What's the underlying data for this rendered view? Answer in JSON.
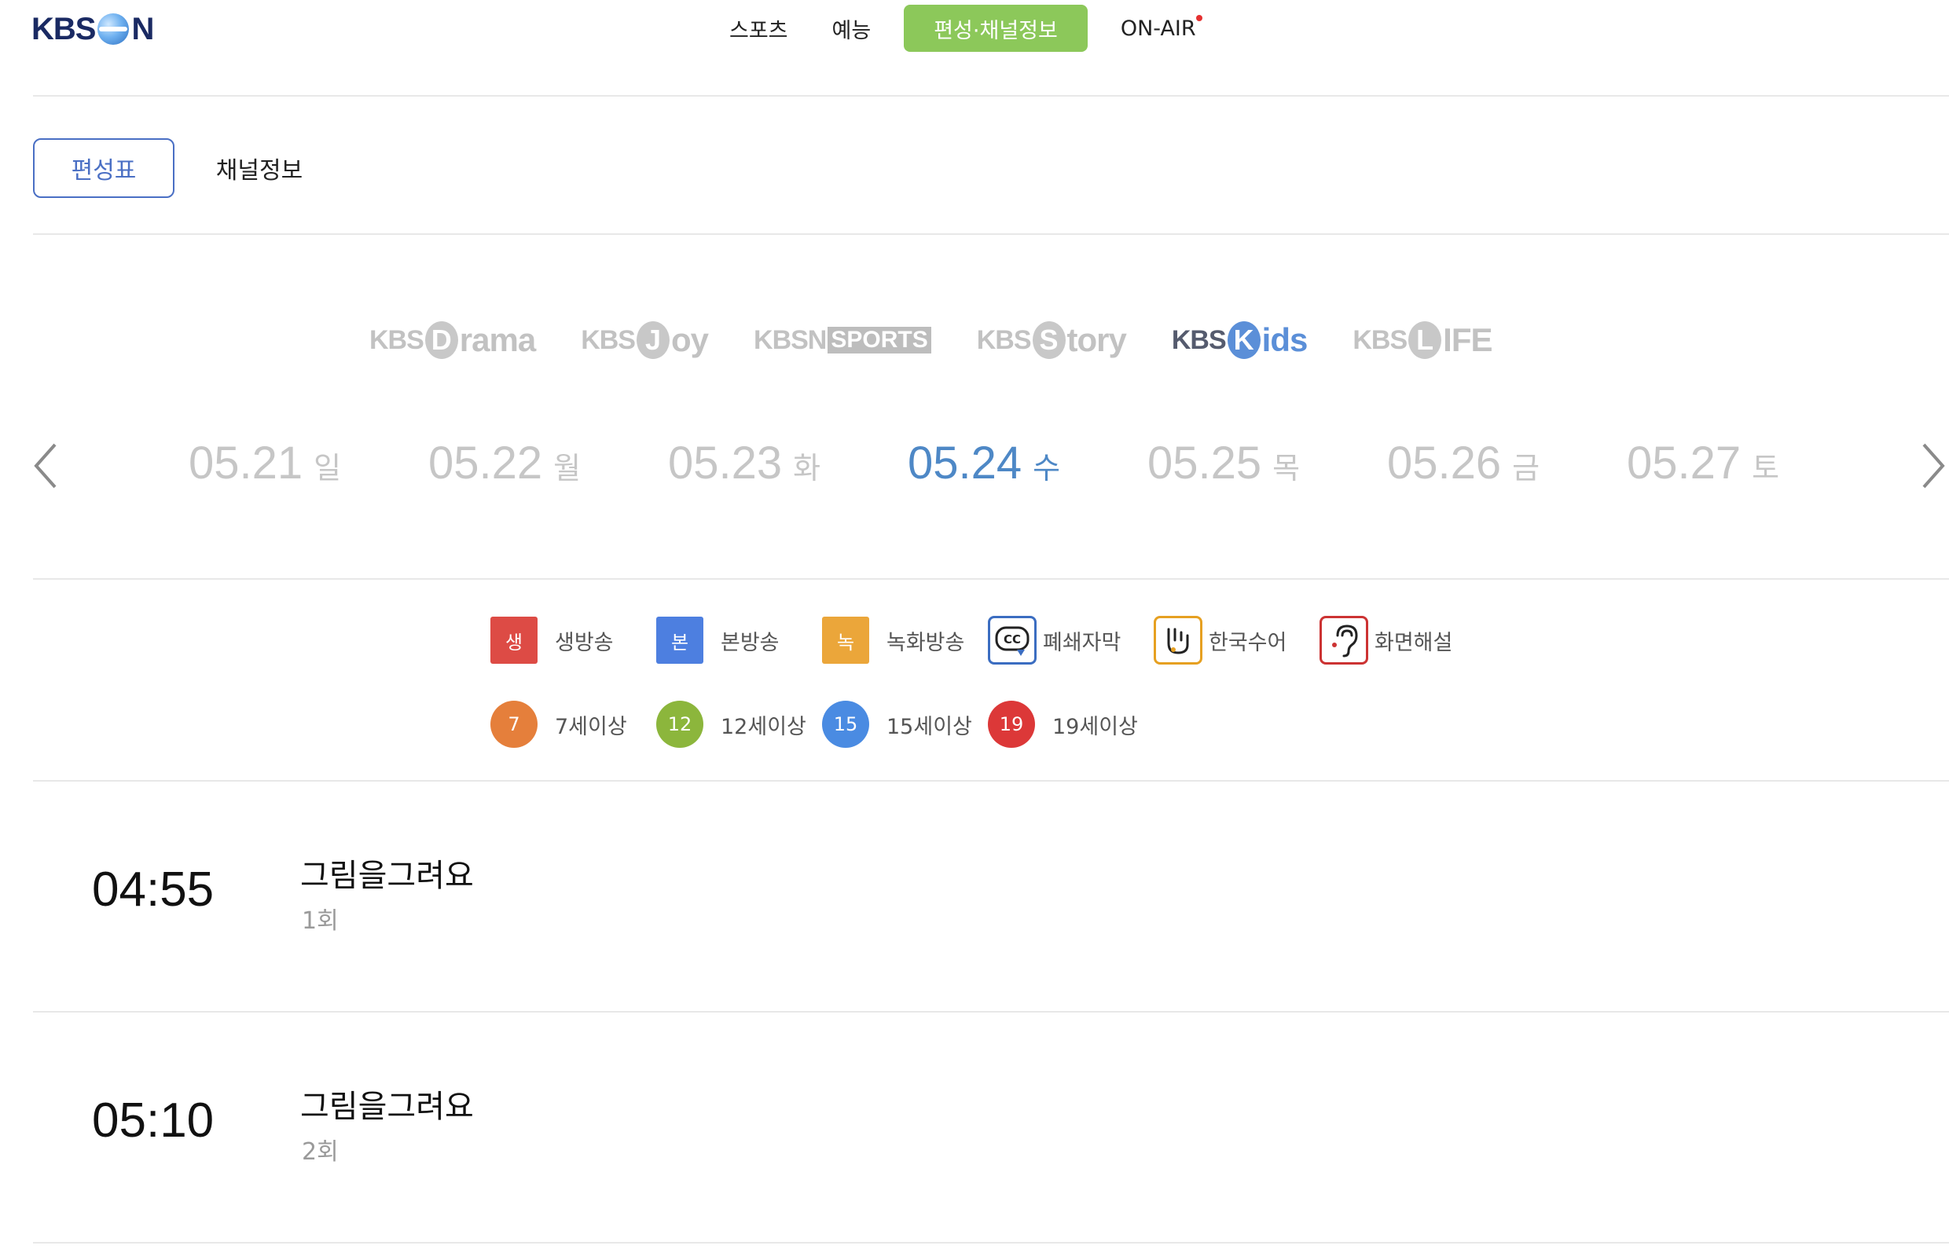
{
  "brand": {
    "logo_left": "KBS",
    "logo_right": "N"
  },
  "topnav": {
    "items": [
      {
        "label": "스포츠"
      },
      {
        "label": "예능"
      },
      {
        "label": "편성·채널정보"
      },
      {
        "label": "ON-AIR"
      }
    ],
    "active_index": 2,
    "active_color": "#8cc85a"
  },
  "subtabs": [
    {
      "label": "편성표",
      "active": true
    },
    {
      "label": "채널정보",
      "active": false
    }
  ],
  "channels": [
    {
      "prefix": "KBS",
      "badge": "D",
      "suffix": "rama"
    },
    {
      "prefix": "KBS",
      "badge": "J",
      "suffix": "oy"
    },
    {
      "prefix": "KBSN",
      "badge": "",
      "suffix": "SPORTS"
    },
    {
      "prefix": "KBS",
      "badge": "S",
      "suffix": "tory"
    },
    {
      "prefix": "KBS",
      "badge": "K",
      "suffix": "ids",
      "selected": true
    },
    {
      "prefix": "KBS",
      "badge": "L",
      "suffix": "IFE"
    }
  ],
  "dates": [
    {
      "date": "05.21",
      "weekday": "일"
    },
    {
      "date": "05.22",
      "weekday": "월"
    },
    {
      "date": "05.23",
      "weekday": "화"
    },
    {
      "date": "05.24",
      "weekday": "수",
      "active": true
    },
    {
      "date": "05.25",
      "weekday": "목"
    },
    {
      "date": "05.26",
      "weekday": "금"
    },
    {
      "date": "05.27",
      "weekday": "토"
    }
  ],
  "legend": {
    "types": [
      {
        "mark": "생",
        "label": "생방송",
        "color": "#dd4b45"
      },
      {
        "mark": "본",
        "label": "본방송",
        "color": "#4d7fe0"
      },
      {
        "mark": "녹",
        "label": "녹화방송",
        "color": "#eba63a"
      }
    ],
    "features": [
      {
        "icon": "closed-caption-icon",
        "label": "폐쇄자막"
      },
      {
        "icon": "sign-language-icon",
        "label": "한국수어"
      },
      {
        "icon": "audio-description-icon",
        "label": "화면해설"
      }
    ],
    "ages": [
      {
        "mark": "7",
        "label": "7세이상",
        "color": "#e57f3b"
      },
      {
        "mark": "12",
        "label": "12세이상",
        "color": "#8cb63c"
      },
      {
        "mark": "15",
        "label": "15세이상",
        "color": "#4a8be2"
      },
      {
        "mark": "19",
        "label": "19세이상",
        "color": "#dc3838"
      }
    ]
  },
  "schedule": [
    {
      "time": "04:55",
      "title": "그림을그려요",
      "episode": "1회"
    },
    {
      "time": "05:10",
      "title": "그림을그려요",
      "episode": "2회"
    }
  ]
}
